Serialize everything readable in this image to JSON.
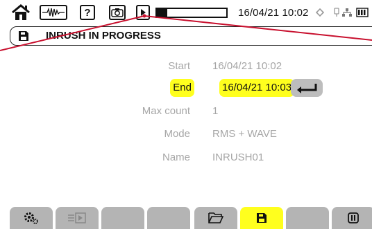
{
  "status_bar": {
    "icons": [
      "home-icon",
      "waveform-icon",
      "help-icon",
      "camera-icon",
      "play-icon"
    ],
    "help_glyph": "?",
    "recording_progress": 0.15,
    "datetime": "16/04/21 10:02",
    "right_icons": [
      "gps-icon",
      "usb-icon",
      "network-icon",
      "battery-icon"
    ]
  },
  "title": {
    "icon": "save-icon",
    "text": "INRUSH IN PROGRESS"
  },
  "form": {
    "start": {
      "label": "Start",
      "value": "16/04/21 10:02"
    },
    "end": {
      "label": "End",
      "value": "16/04/21 10:03"
    },
    "max_count": {
      "label": "Max count",
      "value": "1"
    },
    "mode": {
      "label": "Mode",
      "value": "RMS + WAVE"
    },
    "name": {
      "label": "Name",
      "value": "INRUSH01"
    }
  },
  "colors": {
    "highlight": "#ffff1e",
    "tab_inactive": "#b4b4b4",
    "label_grey": "#a6a6a6",
    "callout_line": "#c8102e"
  },
  "tabs": [
    {
      "icon": "gear-icon",
      "active": false
    },
    {
      "icon": "export-icon",
      "active": false
    },
    {
      "icon": "",
      "active": false
    },
    {
      "icon": "",
      "active": false
    },
    {
      "icon": "folder-icon",
      "active": false
    },
    {
      "icon": "save-icon",
      "active": true
    },
    {
      "icon": "",
      "active": false
    },
    {
      "icon": "pause-icon",
      "active": false
    }
  ]
}
